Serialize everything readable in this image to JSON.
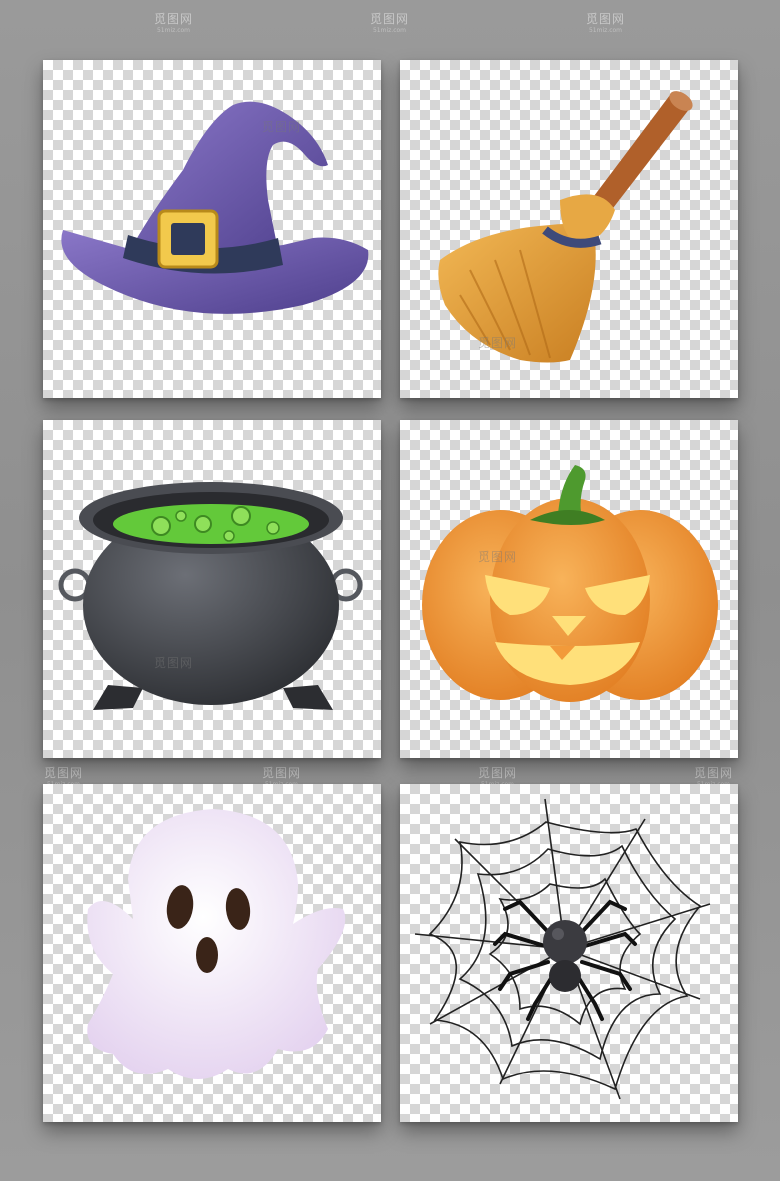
{
  "watermark": {
    "text": "觅图网",
    "sub": "51miz.com"
  },
  "items": [
    {
      "name": "witch-hat"
    },
    {
      "name": "broom"
    },
    {
      "name": "cauldron"
    },
    {
      "name": "jack-o-lantern"
    },
    {
      "name": "ghost"
    },
    {
      "name": "spider-web"
    }
  ],
  "colors": {
    "hat_purple": "#6b5aa8",
    "hat_band": "#2f3a5a",
    "buckle": "#f2c94c",
    "broom_straw": "#e0a03a",
    "broom_handle": "#b0602a",
    "cauldron_body": "#3d3f44",
    "potion_green": "#63c93a",
    "pumpkin_orange": "#f29a3a",
    "pumpkin_face": "#ffe07a",
    "stem_green": "#4e9a2e",
    "ghost_white": "#f6ecf8",
    "web_black": "#222222"
  }
}
